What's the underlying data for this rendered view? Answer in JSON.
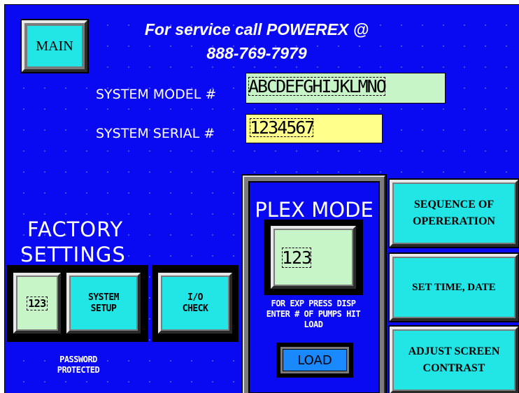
{
  "header": {
    "main_button_label": "MAIN",
    "service_line_1": "For service call POWEREX @",
    "service_line_2": "888-769-7979"
  },
  "system_info": {
    "model_label": "SYSTEM MODEL #",
    "model_value": "ABCDEFGHIJKLMNO",
    "serial_label": "SYSTEM SERIAL #",
    "serial_value": "1234567"
  },
  "factory": {
    "title_line_1": "FACTORY",
    "title_line_2": "SETTINGS",
    "password_input_value": "123",
    "system_setup_label": "SYSTEM SETUP",
    "io_check_label": "I/O CHECK",
    "password_note": "PASSWORD PROTECTED"
  },
  "plex": {
    "title": "PLEX MODE",
    "value": "123",
    "instructions": "FOR EXP PRESS DISP ENTER # OF PUMPS HIT LOAD",
    "load_label": "LOAD"
  },
  "right_buttons": {
    "sequence_label": "SEQUENCE OF OPERERATION",
    "set_time_label": "SET TIME, DATE",
    "contrast_label": "ADJUST SCREEN CONTRAST"
  },
  "colors": {
    "background": "#0a0af2",
    "button_face": "#22e6e6",
    "model_field": "#c8f5c8",
    "serial_field": "#ffff8c",
    "numeric_display": "#c8f5c8"
  }
}
